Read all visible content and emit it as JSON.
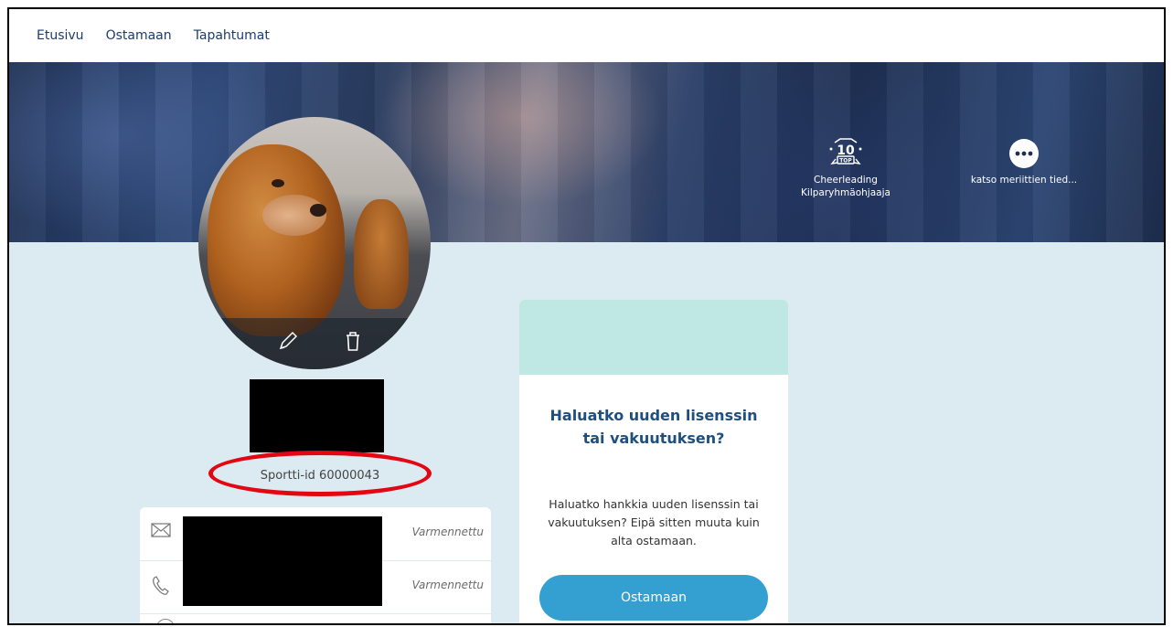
{
  "nav": {
    "items": [
      "Etusivu",
      "Ostamaan",
      "Tapahtumat"
    ]
  },
  "hero": {
    "badges": [
      {
        "icon": "top10-badge-icon",
        "line1": "Cheerleading",
        "line2": "Kilparyhmäohjaaja"
      },
      {
        "icon": "more-dots-icon",
        "line1": "katso meriittien tied..."
      }
    ]
  },
  "profile": {
    "sportti_id": "Sportti-id 60000043",
    "avatar_actions": [
      "pencil-icon",
      "trash-icon"
    ]
  },
  "contact": {
    "rows": [
      {
        "icon": "mail-icon",
        "status": "Varmennettu"
      },
      {
        "icon": "phone-icon",
        "status": "Varmennettu"
      }
    ]
  },
  "license_card": {
    "title": "Haluatko uuden lisenssin tai vakuutuksen?",
    "body": "Haluatko hankkia uuden lisenssin tai vakuutuksen? Eipä sitten muuta kuin alta ostamaan.",
    "button": "Ostamaan"
  },
  "colors": {
    "accent": "#33a0d1",
    "title": "#1f4f7e",
    "background": "#dcebf1",
    "highlight": "#e30613"
  }
}
